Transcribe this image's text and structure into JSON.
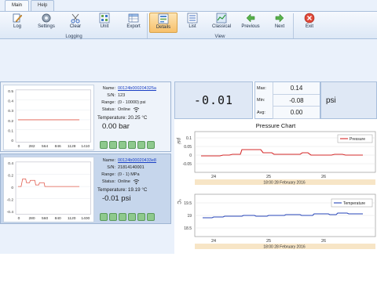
{
  "tabs": [
    "Main",
    "Help"
  ],
  "ribbon": {
    "logging_label": "Logging",
    "view_label": "View",
    "buttons": [
      "Log",
      "Settings",
      "Clear",
      "Unit",
      "Export",
      "Details",
      "List",
      "Classical",
      "Previous",
      "Next",
      "Exit"
    ]
  },
  "sensors": [
    {
      "name_label": "Name:",
      "name": "00124b000204325a",
      "sn_label": "S/N:",
      "sn": "123",
      "range_label": "Range:",
      "range": "(0 - 10000) psi",
      "status_label": "Status:",
      "status": "Online",
      "temp_label": "Temperature:",
      "temp": "20.25 °C",
      "value": "0.00 bar",
      "chart": {
        "yticks": [
          "0.5",
          "0.4",
          "0.3",
          "0.2",
          "0.1",
          "0"
        ],
        "xticks": [
          "0",
          "282",
          "564",
          "846",
          "1128",
          "1410"
        ]
      }
    },
    {
      "name_label": "Name:",
      "name": "00124b00020433e8",
      "sn_label": "S/N:",
      "sn": "21814140001",
      "range_label": "Range:",
      "range": "(0 - 1) MPa",
      "status_label": "Status:",
      "status": "Online",
      "temp_label": "Temperature:",
      "temp": "19.19 °C",
      "value": "-0.01 psi",
      "chart": {
        "yticks": [
          "0.4",
          "0.2",
          "0",
          "-0.2",
          "-0.4"
        ],
        "xticks": [
          "0",
          "280",
          "560",
          "840",
          "1120",
          "1400"
        ]
      }
    }
  ],
  "display": {
    "value": "-0.01",
    "max_label": "Max:",
    "max": "0.14",
    "min_label": "Min:",
    "min": "-0.08",
    "avg_label": "Avg:",
    "avg": "0.00",
    "unit": "psi"
  },
  "pressure_chart": {
    "title": "Pressure Chart",
    "ylabel": "psi",
    "legend": "Pressure",
    "color": "#d62b2b",
    "yticks": [
      "0.1",
      "0.05",
      "0",
      "-0.05"
    ],
    "xticks": [
      "24",
      "25",
      "26"
    ],
    "date_label": "18:00 28 February 2016"
  },
  "temperature_chart": {
    "ylabel": "°C",
    "legend": "Temperature",
    "color": "#2745b8",
    "yticks": [
      "19.5",
      "19",
      "18.5"
    ],
    "xticks": [
      "24",
      "25",
      "26"
    ],
    "date_label": "18:00 28 February 2016"
  }
}
